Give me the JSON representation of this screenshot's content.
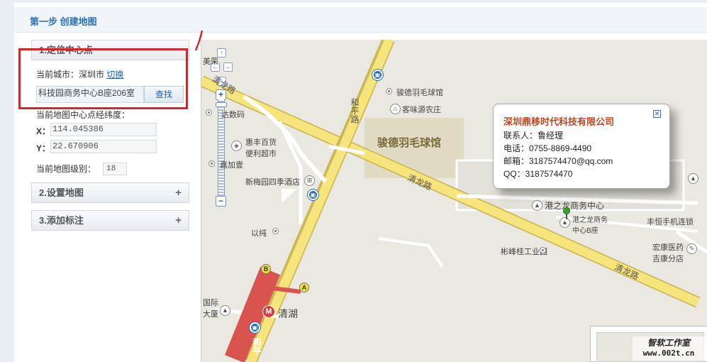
{
  "step": {
    "title": "第一步 创建地图"
  },
  "sidebar": {
    "panel1": {
      "title": "1.定位中心点",
      "toggle": "−",
      "city_label": "当前城市：深圳市",
      "switch_link": "切换",
      "address_value": "科技园商务中心B座206室",
      "find_button": "查找",
      "coord_heading": "当前地图中心点经纬度：",
      "x_label": "X：",
      "x_value": "114.045386",
      "y_label": "Y：",
      "y_value": "22.670906",
      "level_label": "当前地图级别：",
      "level_value": "18"
    },
    "panel2": {
      "title": "2.设置地图",
      "toggle": "+"
    },
    "panel3": {
      "title": "3.添加标注",
      "toggle": "+"
    }
  },
  "map": {
    "labels": {
      "badminton_big": "骏德羽毛球馆",
      "badminton_poi": "骏德羽毛球馆",
      "kewei": "客味源农庄",
      "da_shuma": "达数码",
      "huifeng": "惠丰百货\n便利超市",
      "jiajia": "嘉加壹",
      "xinmeiyuan": "新梅园四季酒店",
      "yichun": "以纯",
      "qinghu": "清湖",
      "guoji": "国际\n大厦",
      "gangzhilong": "港之龙商务中心",
      "gangzhilong_b": "港之龙商务\n中心B座",
      "fengheng": "丰恒手机连锁",
      "hongkang": "宏康医药\n吉康分店",
      "binfeng": "彬峰桂工业园",
      "meimao": "美荣"
    },
    "roads": {
      "qinglong1": "清龙路",
      "qinglong2": "清龙路",
      "qinglong3": "清龙路",
      "heping": "和平路",
      "heping2": "和平"
    },
    "metro_exits": {
      "a": "A",
      "b": "B"
    },
    "info_window": {
      "title": "深圳鼎移时代科技有限公司",
      "contact": "联系人：鲁经理",
      "phone": "电话：0755-8869-4490",
      "email": "邮箱：3187574470@qq.com",
      "qq": "QQ：3187574470",
      "close": "✕"
    },
    "controls": {
      "up": "↑",
      "left": "←",
      "right": "→",
      "down": "↓",
      "zoom_in": "+",
      "zoom_out": "−"
    }
  },
  "watermark": {
    "line1": "智软工作室",
    "line2": "www.002t.cn"
  },
  "colors": {
    "road_major": "#f5e27a",
    "road_minor": "#ffffff",
    "metro_line": "#d9534f",
    "highlight": "#d7262b",
    "title": "#2f6fb5"
  }
}
